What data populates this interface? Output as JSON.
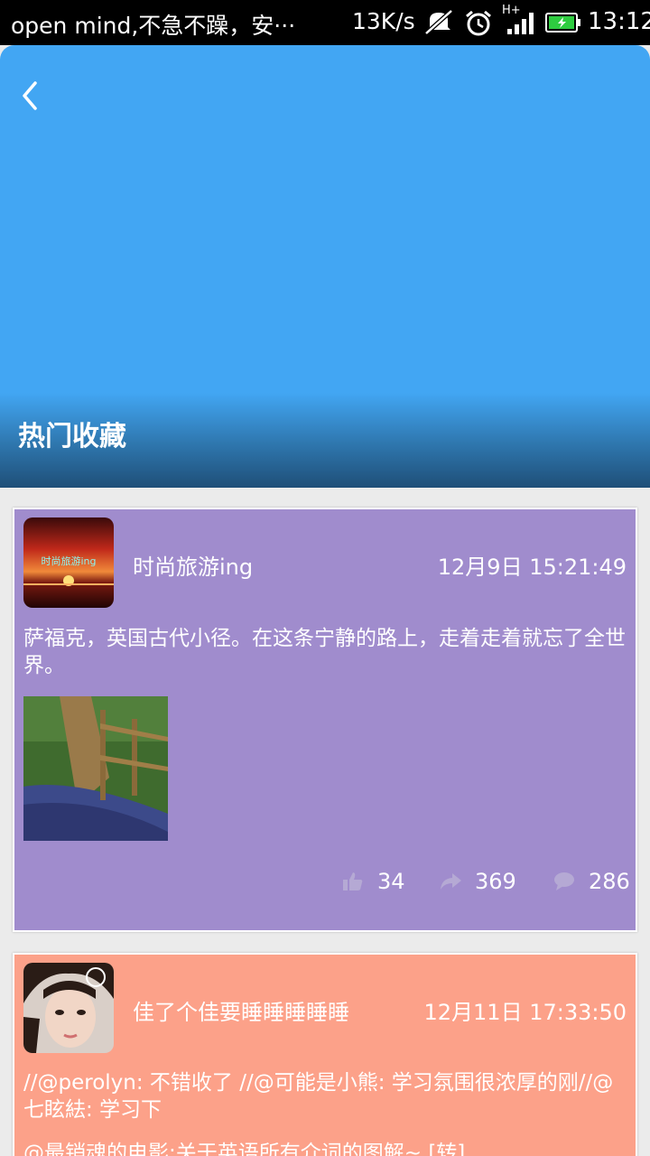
{
  "status_bar": {
    "notification": "open mind,不急不躁，安···",
    "net_speed": "13K/s",
    "network": "H+",
    "time": "13:12",
    "battery_color": "#2ecc40"
  },
  "header": {
    "title": "热门收藏",
    "back_icon": "chevron-left-icon",
    "bg_color": "#42a6f3"
  },
  "posts": [
    {
      "username": "时尚旅游ing",
      "avatar_text": "时尚旅游ing",
      "time": "12月9日 15:21:49",
      "content": "萨福克，英国古代小径。在这条宁静的路上，走着走着就忘了全世界。",
      "likes": "34",
      "shares": "369",
      "comments": "286",
      "bg_color": "#a08ccd"
    },
    {
      "username": "佳了个佳要睡睡睡睡睡",
      "time": "12月11日 17:33:50",
      "content": "//@perolyn: 不错收了 //@可能是小熊: 学习氛围很浓厚的刚//@七眩紶: 学习下",
      "content_more": "@最销魂的电影:关于英语所有介词的图解~ [转]",
      "bg_color": "#fca189"
    }
  ]
}
